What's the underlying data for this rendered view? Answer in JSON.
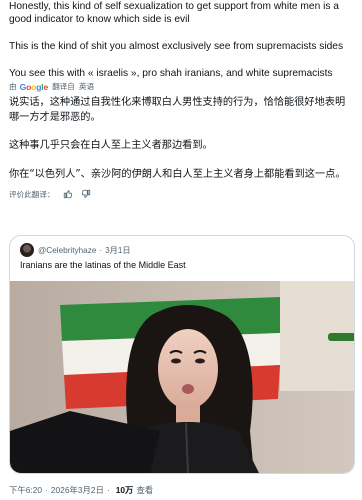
{
  "post": {
    "paragraphs": [
      "Honestly, this kind of self sexualization to get support from white men is a good indicator to know which side is evil",
      "This is the kind of shit you almost exclusively see from supremacists sides",
      "You see this with « israelis », pro shah iranians, and white supremacists"
    ],
    "translated_by_label": "由",
    "google_logo": "Google",
    "translate_label": "翻译自",
    "source_language": "英语",
    "translation": [
      "说实话，这种通过自我性化来博取白人男性支持的行为，恰恰能很好地表明哪一方才是邪恶的。",
      "这种事几乎只会在白人至上主义者那边看到。",
      "你在“以色列人”、亲沙阿的伊朗人和白人至上主义者身上都能看到这一点。"
    ],
    "rate_translation_label": "评价此翻译："
  },
  "quote": {
    "handle": "@Celebrityhaze",
    "date": "3月1日",
    "text": "Iranians are the latinas of the Middle East"
  },
  "footer": {
    "time": "下午6:20",
    "date": "2026年3月2日",
    "views_count": "10万",
    "views_label": "查看"
  }
}
